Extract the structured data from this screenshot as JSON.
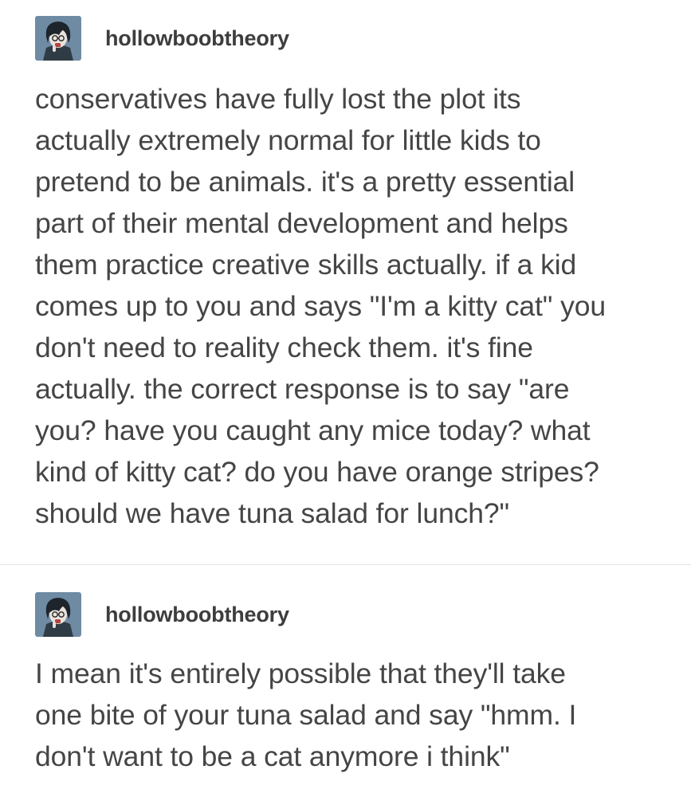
{
  "posts": [
    {
      "username": "hollowboobtheory",
      "avatar_icon": "avatar-illustration-icon",
      "body": "conservatives have fully lost the plot its\nactually extremely normal for little kids to\npretend to be animals. it's a pretty essential\npart of their mental development and helps\nthem practice creative skills actually. if a kid\ncomes up to you and says \"I'm a kitty cat\" you\ndon't need to reality check them. it's fine\nactually. the correct response is to say \"are\nyou? have you caught any mice today? what\nkind of kitty cat? do you have orange stripes?\nshould we have tuna salad for lunch?\""
    },
    {
      "username": "hollowboobtheory",
      "avatar_icon": "avatar-illustration-icon",
      "body": "I mean it's entirely possible that they'll take\none bite of your tuna salad and say \"hmm. I\ndon't want to be a cat anymore i think\""
    }
  ],
  "colors": {
    "text": "#454545",
    "username": "#3d3d3d",
    "divider": "#e4e4e4",
    "avatar_bg": "#6f8aa3"
  }
}
